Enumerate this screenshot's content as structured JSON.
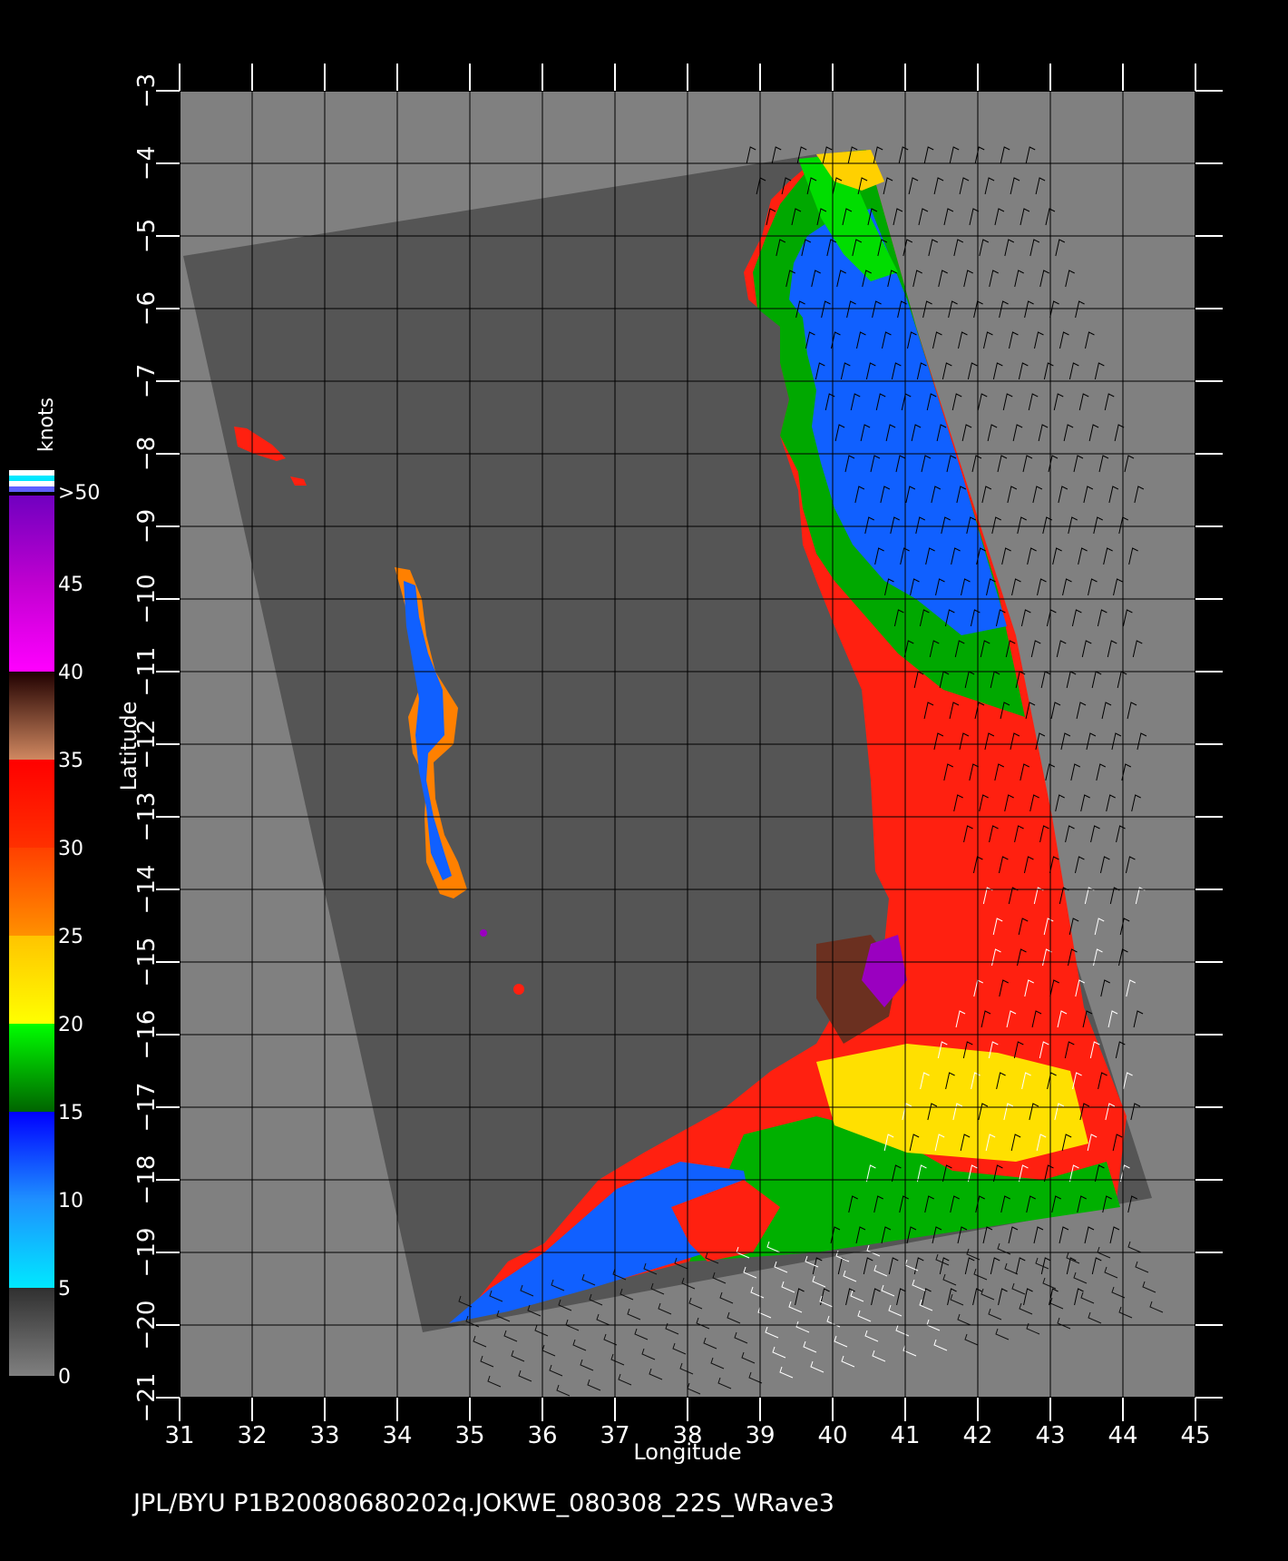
{
  "map": {
    "x_axis": {
      "label": "Longitude",
      "min": 31,
      "max": 45,
      "ticks": [
        "31",
        "32",
        "33",
        "34",
        "35",
        "36",
        "37",
        "38",
        "39",
        "40",
        "41",
        "42",
        "43",
        "44",
        "45"
      ]
    },
    "y_axis": {
      "label": "Latitude",
      "min": -21,
      "max": -3,
      "ticks": [
        "-3",
        "-4",
        "-5",
        "-6",
        "-7",
        "-8",
        "-9",
        "-10",
        "-11",
        "-12",
        "-13",
        "-14",
        "-15",
        "-16",
        "-17",
        "-18",
        "-19",
        "-20",
        "-21"
      ]
    },
    "grid": true,
    "background_color": "#808080",
    "swath_color": "#555555"
  },
  "colorbar": {
    "unit": "knots",
    "labels": [
      ">50",
      "45",
      "40",
      "35",
      "30",
      "25",
      "20",
      "15",
      "10",
      "5",
      "0"
    ],
    "segments": [
      {
        "from": 0,
        "to": 5,
        "colors": [
          "#808080",
          "#303030"
        ]
      },
      {
        "from": 5,
        "to": 10,
        "colors": [
          "#00e8ff",
          "#1e90ff"
        ]
      },
      {
        "from": 10,
        "to": 15,
        "colors": [
          "#1e90ff",
          "#0000ff"
        ]
      },
      {
        "from": 15,
        "to": 20,
        "colors": [
          "#006400",
          "#00ff00"
        ]
      },
      {
        "from": 20,
        "to": 25,
        "colors": [
          "#ffff00",
          "#ffc400"
        ]
      },
      {
        "from": 25,
        "to": 30,
        "colors": [
          "#ff9000",
          "#ff4000"
        ]
      },
      {
        "from": 30,
        "to": 35,
        "colors": [
          "#ff3000",
          "#ff0000"
        ]
      },
      {
        "from": 35,
        "to": 40,
        "colors": [
          "#d08860",
          "#200000"
        ]
      },
      {
        "from": 40,
        "to": 45,
        "colors": [
          "#ff00ff",
          "#c000d0"
        ]
      },
      {
        "from": 45,
        "to": 50,
        "colors": [
          "#c000d0",
          "#7000c0"
        ]
      }
    ],
    "top_marker_colors": [
      "#ffffff",
      "#00e8ff",
      "#ffffff",
      "#6060ff"
    ]
  },
  "footer": {
    "text": "JPL/BYU  P1B20080680202q.JOKWE_080308_22S_WRave3"
  }
}
